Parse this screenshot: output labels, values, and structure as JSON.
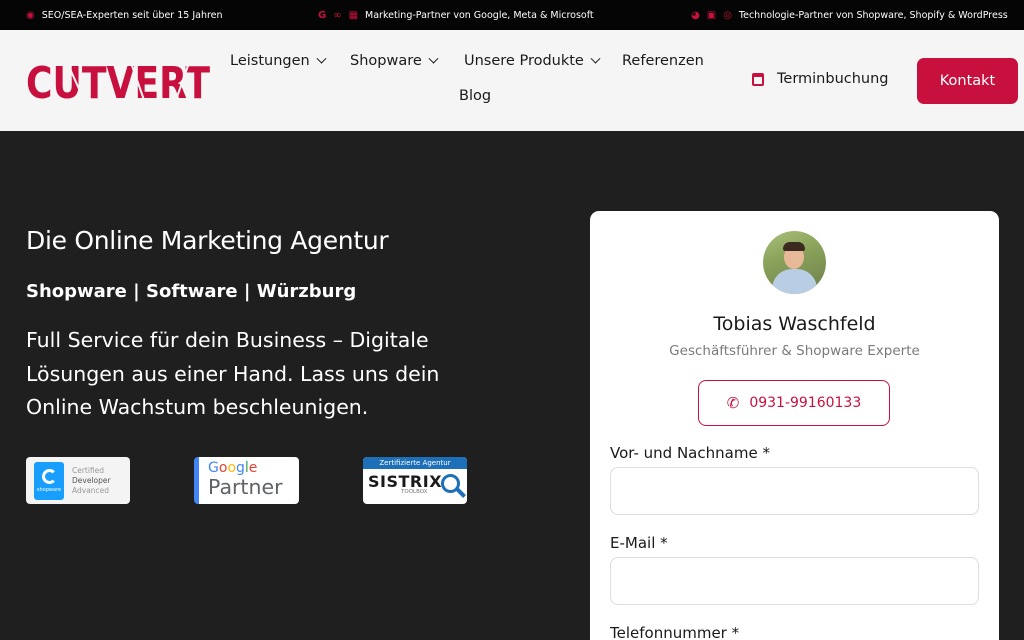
{
  "topbar": {
    "items": [
      {
        "icons": [
          "location-pin-icon"
        ],
        "text": "SEO/SEA-Experten seit über 15 Jahren"
      },
      {
        "icons": [
          "google-icon",
          "meta-icon",
          "microsoft-icon"
        ],
        "text": "Marketing-Partner von Google, Meta & Microsoft"
      },
      {
        "icons": [
          "shopware-icon",
          "shopify-icon",
          "wordpress-icon"
        ],
        "text": "Technologie-Partner von Shopware, Shopify & WordPress"
      }
    ]
  },
  "header": {
    "logo": "CUTVERT",
    "nav": [
      {
        "label": "Leistungen",
        "dropdown": true
      },
      {
        "label": "Shopware",
        "dropdown": true
      },
      {
        "label": "Unsere Produkte",
        "dropdown": true
      },
      {
        "label": "Referenzen",
        "dropdown": false
      },
      {
        "label": "Blog",
        "dropdown": false
      }
    ],
    "booking_label": "Terminbuchung",
    "contact_label": "Kontakt"
  },
  "hero": {
    "title": "Die Online Marketing Agentur",
    "subtitle": "Shopware | Software | Würzburg",
    "description": "Full Service für dein Business – Digitale Lösungen aus einer Hand. Lass uns dein Online Wachstum beschleunigen."
  },
  "badges": {
    "shopware": {
      "mark": "shopware",
      "line1": "Certified",
      "line2": "Developer",
      "line3": "Advanced"
    },
    "google": {
      "line1": "Google",
      "line2": "Partner"
    },
    "sistrix": {
      "top": "Zertifizierte Agentur",
      "main": "SISTRIX",
      "sub": "TOOLBOX"
    }
  },
  "contact_card": {
    "name": "Tobias Waschfeld",
    "role": "Geschäftsführer & Shopware Experte",
    "phone": "0931-99160133",
    "fields": [
      {
        "label": "Vor- und Nachname *",
        "value": ""
      },
      {
        "label": "E-Mail *",
        "value": ""
      },
      {
        "label": "Telefonnummer *",
        "value": ""
      }
    ]
  },
  "colors": {
    "accent": "#c8103e",
    "dark_bg": "#1f1f1f",
    "topbar_bg": "#050505",
    "header_bg": "#f5f5f5"
  }
}
